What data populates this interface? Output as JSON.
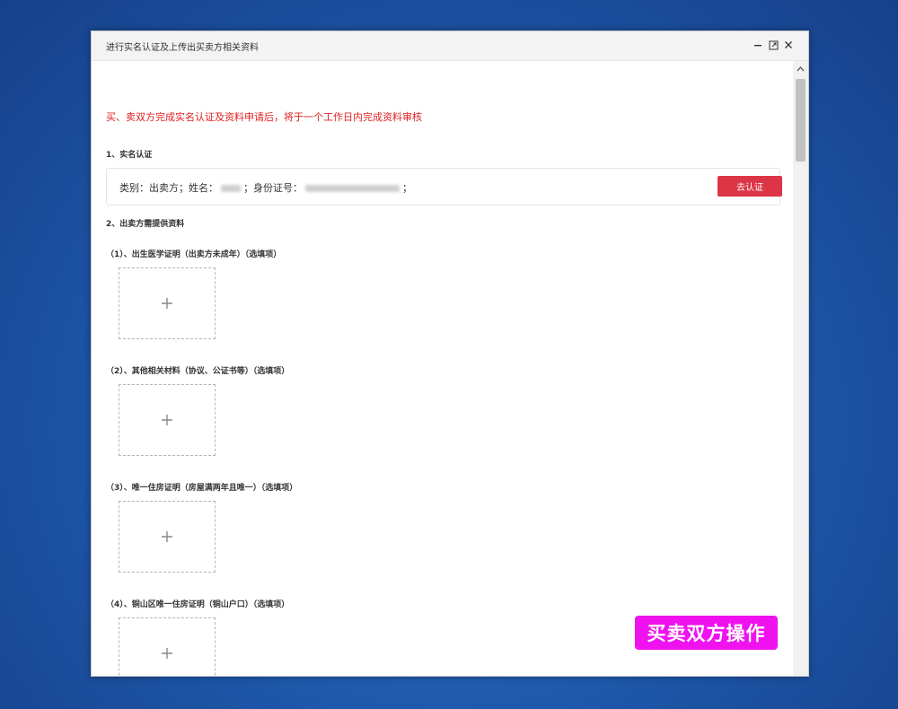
{
  "dialog": {
    "title": "进行实名认证及上传出买卖方相关资料",
    "controls": {
      "minimize_icon": "minimize-icon",
      "maximize_icon": "maximize-icon",
      "close_icon": "close-icon"
    }
  },
  "notice": "买、卖双方完成实名认证及资料申请后，将于一个工作日内完成资料审核",
  "section1": {
    "title": "1、实名认证",
    "id_label_prefix": "类别：出卖方；姓名：",
    "id_label_mid": "；身份证号：",
    "id_label_suffix": "；",
    "verify_button": "去认证"
  },
  "section2": {
    "title": "2、出卖方需提供资料",
    "items": [
      {
        "label": "（1）、出生医学证明（出卖方未成年）（选填项）",
        "upload_symbol": "+"
      },
      {
        "label": "（2）、其他相关材料（协议、公证书等）（选填项）",
        "upload_symbol": "+"
      },
      {
        "label": "（3）、唯一住房证明（房屋满两年且唯一）（选填项）",
        "upload_symbol": "+"
      },
      {
        "label": "（4）、铜山区唯一住房证明（铜山户口）（选填项）",
        "upload_symbol": "+"
      }
    ]
  },
  "overlay_badge": "买卖双方操作",
  "colors": {
    "accent_red": "#e02020",
    "button_red": "#dc3545",
    "badge_magenta": "#ef12ef",
    "background_blue": "#1d55a6"
  }
}
